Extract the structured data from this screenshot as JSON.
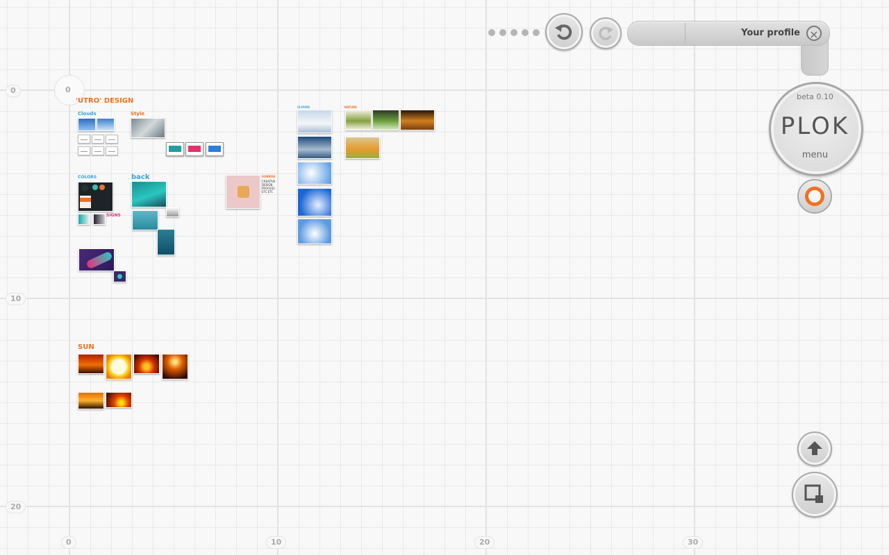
{
  "axes": {
    "x_labels": [
      "0",
      "10",
      "20",
      "30"
    ],
    "y_labels": [
      "0",
      "10",
      "20"
    ],
    "origin_label": "0"
  },
  "toolbar": {
    "pager_dots": 5,
    "profile_label": "Your profile",
    "close_symbol": "×"
  },
  "brand": {
    "beta": "beta 0.10",
    "logo": "PLOK",
    "menu": "menu"
  },
  "canvas": {
    "utro_title": "'UTRO' DESIGN",
    "clouds_label": "Clouds",
    "style_label": "Style",
    "colors_label": "COLORS",
    "back_label": "back",
    "signs_label": "SIGNS",
    "sun_title": "SUN",
    "clouds2_label": "CLOUDS",
    "nature_label": "NATURE",
    "note_title": "SUNRISE",
    "note_body": "CREATIVE DESIGN PROCESS ETC ETC"
  },
  "icons": {
    "undo": "undo-icon",
    "redo": "redo-icon",
    "close": "close-icon",
    "record": "record-icon",
    "upload": "upload-arrow-icon",
    "resize": "resize-window-icon"
  },
  "colors": {
    "accent": "#f07020",
    "label_blue": "#3aa0dc",
    "label_pink": "#e0307a"
  }
}
